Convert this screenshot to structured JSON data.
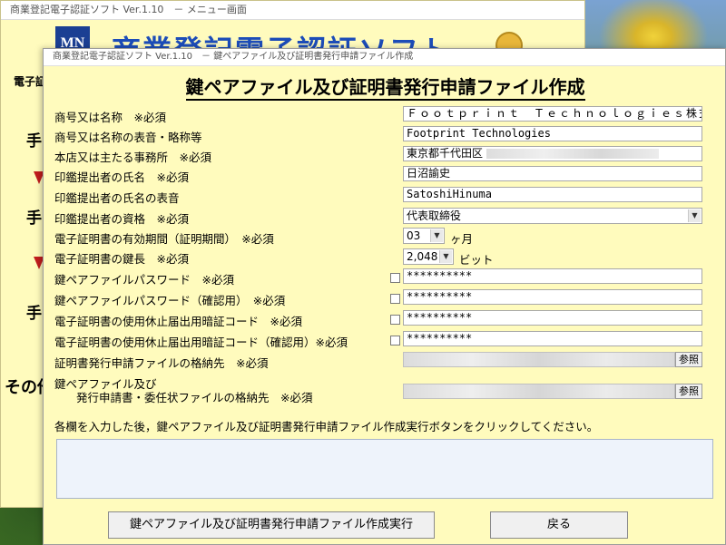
{
  "back_window": {
    "title": "商業登記電子認証ソフト Ver.1.10　－ メニュー画面",
    "logo": "MN",
    "banner": "商業登記電子認証ソフト",
    "subheading": "電子証",
    "steps": [
      "手",
      "手",
      "手"
    ],
    "other": "その他"
  },
  "dialog": {
    "title": "商業登記電子認証ソフト Ver.1.10　－ 鍵ペアファイル及び証明書発行申請ファイル作成",
    "heading": "鍵ペアファイル及び証明書発行申請ファイル作成",
    "fields": {
      "company_name": {
        "label": "商号又は名称　※必須",
        "value": "Ｆｏｏｔｐｒｉｎｔ　Ｔｅｃｈｎｏｌｏｇｉｅｓ株式"
      },
      "company_reading": {
        "label": "商号又は名称の表音・略称等",
        "value": "Footprint Technologies"
      },
      "office": {
        "label": "本店又は主たる事務所　※必須",
        "value": "東京都千代田区"
      },
      "seal_name": {
        "label": "印鑑提出者の氏名　※必須",
        "value": "日沼諭史"
      },
      "seal_reading": {
        "label": "印鑑提出者の氏名の表音",
        "value": "SatoshiHinuma"
      },
      "seal_qualification": {
        "label": "印鑑提出者の資格　※必須",
        "value": "代表取締役"
      },
      "validity": {
        "label": "電子証明書の有効期間（証明期間）　※必須",
        "value": "03",
        "unit": "ヶ月"
      },
      "key_length": {
        "label": "電子証明書の鍵長　※必須",
        "value": "2,048",
        "unit": "ビット"
      },
      "key_password": {
        "label": "鍵ペアファイルパスワード　※必須",
        "value": "**********"
      },
      "key_password_confirm": {
        "label": "鍵ペアファイルパスワード（確認用）　※必須",
        "value": "**********"
      },
      "suspend_code": {
        "label": "電子証明書の使用休止届出用暗証コード　※必須",
        "value": "**********"
      },
      "suspend_code_confirm": {
        "label": "電子証明書の使用休止届出用暗証コード（確認用）※必須",
        "value": "**********"
      },
      "request_file_dir": {
        "label": "証明書発行申請ファイルの格納先　※必須",
        "button": "参照"
      },
      "key_file_dir": {
        "label1": "鍵ペアファイル及び",
        "label2": "発行申請書・委任状ファイルの格納先　※必須",
        "button": "参照"
      }
    },
    "instruction": "各欄を入力した後，鍵ペアファイル及び証明書発行申請ファイル作成実行ボタンをクリックしてください。",
    "execute_button": "鍵ペアファイル及び証明書発行申請ファイル作成実行",
    "back_button": "戻る"
  }
}
